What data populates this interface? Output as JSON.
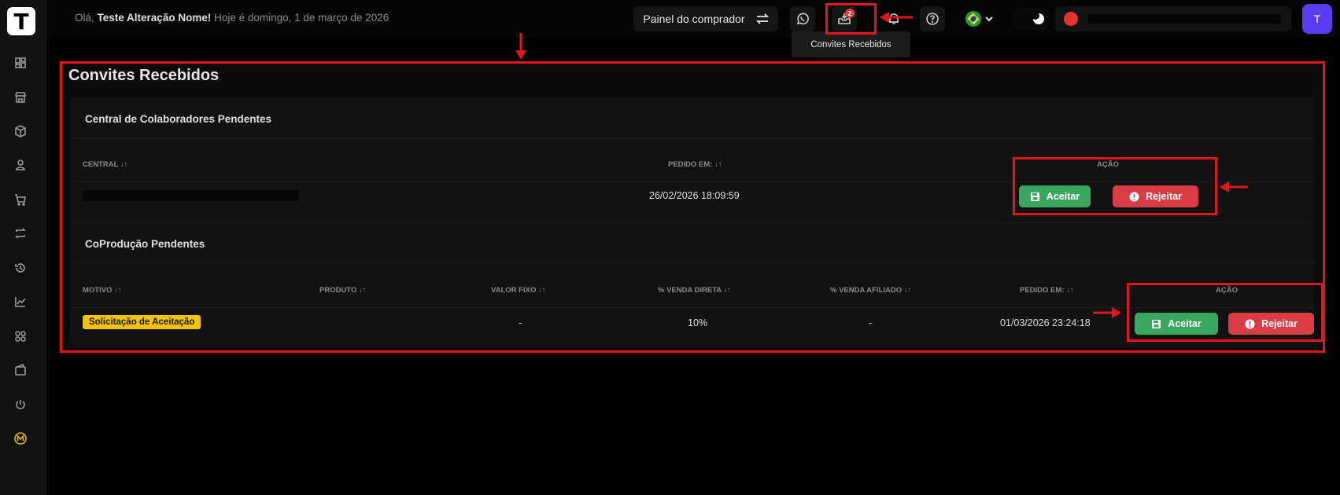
{
  "topbar": {
    "greeting_prefix": "Olá,",
    "user_name": "Teste Alteração Nome!",
    "date_text": "Hoje é domingo, 1 de março de 2026",
    "buyer_panel_label": "Painel do comprador",
    "invites_badge": "2",
    "avatar_initial": "T",
    "tooltip": "Convites Recebidos"
  },
  "logo_letter": "T",
  "page": {
    "title": "Convites Recebidos"
  },
  "central_section": {
    "title": "Central de Colaboradores Pendentes",
    "headers": {
      "central": "CENTRAL",
      "ordered_at": "PEDIDO EM:",
      "action": "AÇÃO"
    },
    "rows": [
      {
        "ordered_at": "26/02/2026 18:09:59",
        "accept_label": "Aceitar",
        "reject_label": "Rejeitar"
      }
    ]
  },
  "coproduction_section": {
    "title": "CoProdução Pendentes",
    "headers": {
      "reason": "MOTIVO",
      "product": "PRODUTO",
      "fixed_value": "VALOR FIXO",
      "direct_sale": "% VENDA DIRETA",
      "affiliate_sale": "% VENDA AFILIADO",
      "ordered_at": "PEDIDO EM:",
      "action": "AÇÃO"
    },
    "rows": [
      {
        "reason": "Solicitação de Aceitação",
        "fixed_value": "-",
        "direct_sale": "10%",
        "affiliate_sale": "-",
        "ordered_at": "01/03/2026 23:24:18",
        "accept_label": "Aceitar",
        "reject_label": "Rejeitar"
      }
    ]
  },
  "sort_glyph": "↓↑",
  "colors": {
    "accept": "#3aa760",
    "reject": "#d93c44",
    "tag": "#f5c400",
    "annotation": "#e0161c",
    "avatar": "#5b3cf0"
  }
}
